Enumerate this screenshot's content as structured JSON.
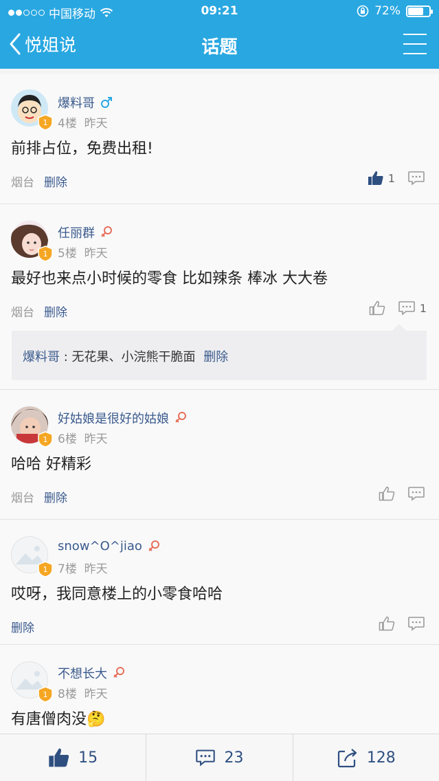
{
  "status_bar": {
    "carrier": "中国移动",
    "time": "09:21",
    "battery": "72%",
    "battery_level": 0.72
  },
  "nav": {
    "back_label": "悦姐说",
    "title": "话题"
  },
  "comments": [
    {
      "name": "爆料哥",
      "gender": "male",
      "floor": "4楼",
      "time": "昨天",
      "text": "前排占位，免费出租!",
      "loc": "烟台",
      "delete": "删除",
      "likes": "1",
      "liked": true,
      "reply_count": ""
    },
    {
      "name": "任丽群",
      "gender": "female",
      "floor": "5楼",
      "time": "昨天",
      "text": "最好也来点小时候的零食 比如辣条 棒冰 大大卷",
      "loc": "烟台",
      "delete": "删除",
      "likes": "",
      "liked": false,
      "reply_count": "1",
      "reply": {
        "name": "爆料哥",
        "separator": " : ",
        "text": "无花果、小浣熊干脆面",
        "delete": "删除"
      }
    },
    {
      "name": "好姑娘是很好的姑娘",
      "gender": "female",
      "floor": "6楼",
      "time": "昨天",
      "text": "哈哈 好精彩",
      "loc": "烟台",
      "delete": "删除",
      "likes": "",
      "liked": false,
      "reply_count": ""
    },
    {
      "name": "snow^O^jiao",
      "gender": "female",
      "floor": "7楼",
      "time": "昨天",
      "text": "哎呀，我同意楼上的小零食哈哈",
      "loc": "",
      "delete": "删除",
      "likes": "",
      "liked": false,
      "reply_count": ""
    },
    {
      "name": "不想长大",
      "gender": "female",
      "floor": "8楼",
      "time": "昨天",
      "text": "有唐僧肉没🤔",
      "loc": "",
      "delete": "",
      "likes": "",
      "liked": false,
      "reply_count": ""
    }
  ],
  "bottom_bar": {
    "likes": "15",
    "comments": "23",
    "shares": "128"
  },
  "colors": {
    "header": "#29a7e1",
    "link": "#3a5a8c",
    "badge": "#f5a623",
    "female": "#e8705a",
    "male": "#29a7e1"
  }
}
